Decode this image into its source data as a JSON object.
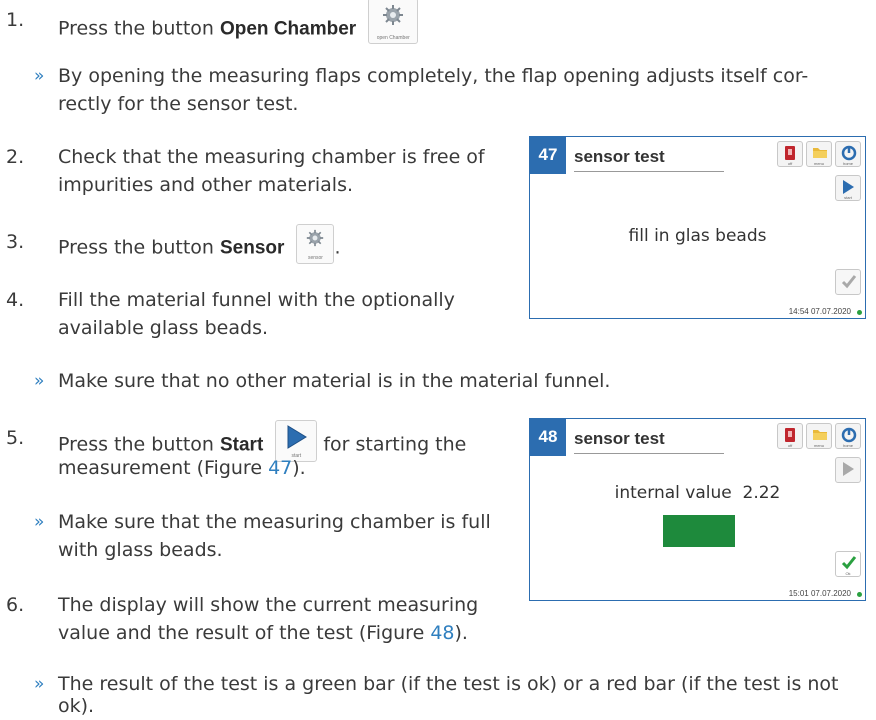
{
  "steps": [
    {
      "num": "1.",
      "prefix": "Press the button ",
      "bold": "Open Chamber",
      "button_caption": "open Chamber"
    },
    {
      "num": "2.",
      "line1": "Check that the measuring chamber is free of",
      "line2": "impurities and other materials."
    },
    {
      "num": "3.",
      "prefix": "Press the button ",
      "bold": "Sensor",
      "suffix": ".",
      "button_caption": "sensor"
    },
    {
      "num": "4.",
      "line1": "Fill the material funnel with the optionally",
      "line2": "available glass beads."
    },
    {
      "num": "5.",
      "prefix": "Press the button ",
      "bold": "Start",
      "after": "for starting the",
      "line2_prefix": "measurement (Figure ",
      "line2_link": "47",
      "line2_suffix": ").",
      "button_caption": "start"
    },
    {
      "num": "6.",
      "line1": "The display will show the current measuring",
      "line2_prefix": "value and the result of the test (Figure ",
      "line2_link": "48",
      "line2_suffix": ")."
    }
  ],
  "notes": [
    {
      "symbol": "»",
      "line1": "By opening the measuring flaps completely, the flap opening adjusts itself cor-",
      "line2": "rectly for the sensor test."
    },
    {
      "symbol": "»",
      "line1": "Make sure that no other material is in the material funnel."
    },
    {
      "symbol": "»",
      "line1": "Make sure that the measuring chamber is full",
      "line2": "with glass beads."
    },
    {
      "symbol": "»",
      "line1": "The result of the test is a green bar (if the test is ok) or a red bar (if the test is not",
      "line2": "ok)."
    }
  ],
  "figures": [
    {
      "number": "47",
      "title": "sensor test",
      "message": "fill in glas beads",
      "toolbar": {
        "off": "off",
        "menu": "menu",
        "home": "home"
      },
      "start_caption": "start",
      "ok_caption": "",
      "timestamp": "14:54 07.07.2020",
      "status_color": "#2aa040"
    },
    {
      "number": "48",
      "title": "sensor test",
      "value_label": "internal value",
      "value": "2.22",
      "result_color": "#1e8a3c",
      "toolbar": {
        "off": "off",
        "menu": "menu",
        "home": "home"
      },
      "start_caption": "start",
      "ok_caption": "Ok",
      "timestamp": "15:01 07.07.2020",
      "status_color": "#2aa040"
    }
  ]
}
